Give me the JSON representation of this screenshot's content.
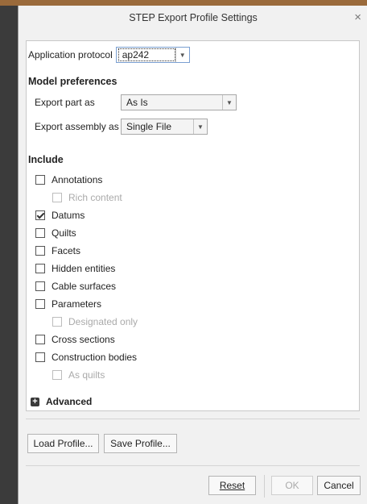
{
  "dialog": {
    "title": "STEP Export Profile Settings",
    "close_glyph": "×"
  },
  "protocol": {
    "label": "Application protocol",
    "value": "ap242"
  },
  "model_preferences": {
    "heading": "Model preferences",
    "export_part": {
      "label": "Export part as",
      "value": "As Is"
    },
    "export_assembly": {
      "label": "Export assembly as",
      "value": "Single File"
    }
  },
  "include": {
    "heading": "Include",
    "items": [
      {
        "label": "Annotations",
        "checked": false,
        "enabled": true
      },
      {
        "label": "Rich content",
        "checked": false,
        "enabled": false
      },
      {
        "label": "Datums",
        "checked": true,
        "enabled": true
      },
      {
        "label": "Quilts",
        "checked": false,
        "enabled": true
      },
      {
        "label": "Facets",
        "checked": false,
        "enabled": true
      },
      {
        "label": "Hidden entities",
        "checked": false,
        "enabled": true
      },
      {
        "label": "Cable surfaces",
        "checked": false,
        "enabled": true
      },
      {
        "label": "Parameters",
        "checked": false,
        "enabled": true
      },
      {
        "label": "Designated only",
        "checked": false,
        "enabled": false
      },
      {
        "label": "Cross sections",
        "checked": false,
        "enabled": true
      },
      {
        "label": "Construction bodies",
        "checked": false,
        "enabled": true
      },
      {
        "label": "As quilts",
        "checked": false,
        "enabled": false
      }
    ]
  },
  "advanced": {
    "label": "Advanced",
    "expand_glyph": "+"
  },
  "buttons": {
    "load_profile": "Load Profile...",
    "save_profile": "Save Profile...",
    "reset": "Reset",
    "ok": "OK",
    "cancel": "Cancel"
  }
}
